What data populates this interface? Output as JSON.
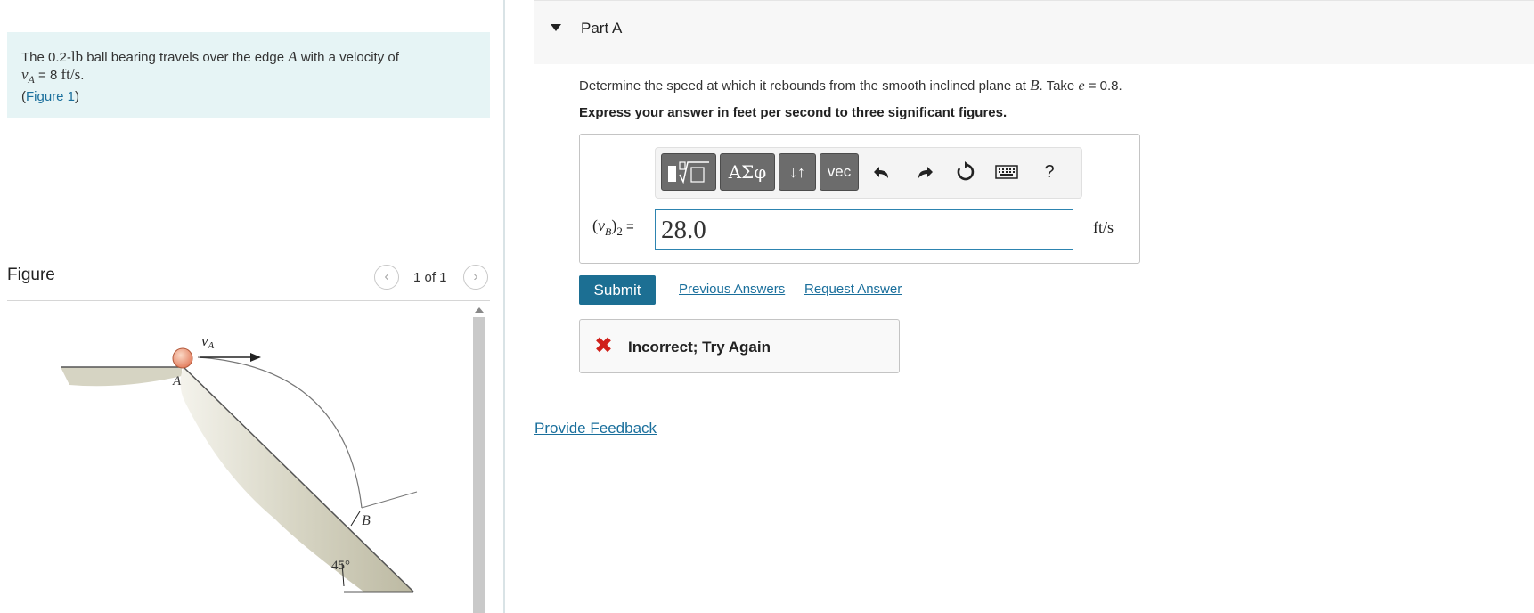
{
  "problem": {
    "text_prefix": "The 0.2-",
    "weight_unit": "lb",
    "text_mid": " ball bearing travels over the edge ",
    "edge_label": "A",
    "text_suffix": " with a velocity of",
    "velocity_symbol": "v",
    "velocity_subscript": "A",
    "velocity_eq": " = 8 ",
    "velocity_unit": "ft/s",
    "period": ".",
    "open_paren": "(",
    "figure_link": "Figure 1",
    "close_paren": ")"
  },
  "figure": {
    "title": "Figure",
    "counter": "1 of 1",
    "labels": {
      "velocity_symbol": "v",
      "velocity_subscript": "A",
      "point_a": "A",
      "point_b": "B",
      "angle": "45°"
    }
  },
  "part": {
    "title": "Part A",
    "question_prefix": "Determine the speed at which it rebounds from the smooth inclined plane at ",
    "question_point": "B",
    "question_mid": ". Take ",
    "question_var": "e",
    "question_suffix": " = 0.8.",
    "instruction": "Express your answer in feet per second to three significant figures."
  },
  "toolbar": {
    "greek_label": "ΑΣφ",
    "arrows_label": "↓↑",
    "vec_label": "vec",
    "help_label": "?"
  },
  "answer": {
    "label_prefix": "(",
    "label_var": "v",
    "label_sub": "B",
    "label_suffix": ")",
    "label_sub2": "2",
    "label_eq": " =",
    "value": "28.0",
    "unit": "ft/s"
  },
  "actions": {
    "submit": "Submit",
    "previous_answers": "Previous Answers",
    "request_answer": "Request Answer"
  },
  "feedback": {
    "icon": "✖",
    "text": "Incorrect; Try Again"
  },
  "footer": {
    "provide_feedback": "Provide Feedback"
  },
  "colors": {
    "problem_bg": "#e6f4f5",
    "link": "#1a6f9c",
    "submit_bg": "#1c6f93",
    "error": "#d0201a",
    "input_border": "#2d84b0"
  }
}
